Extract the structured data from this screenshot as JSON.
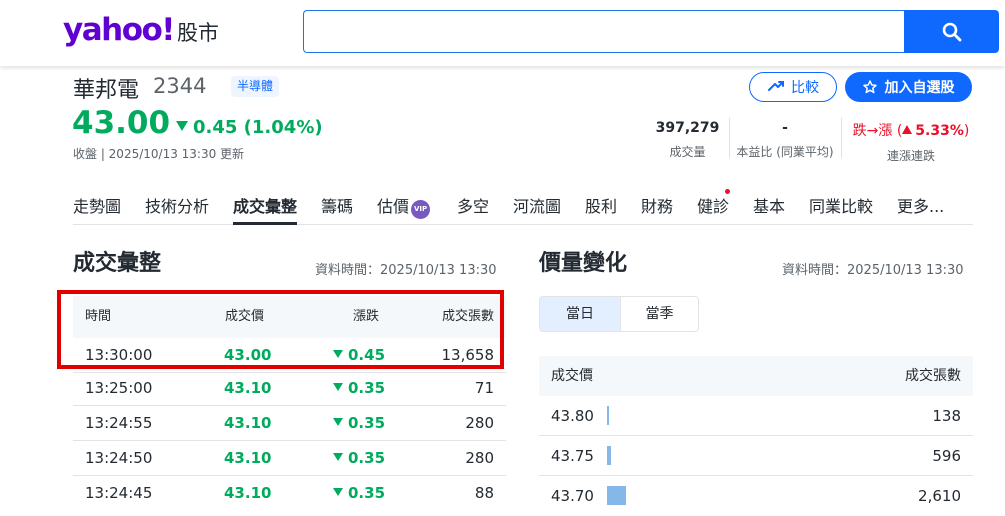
{
  "header": {
    "logo_word": "yahoo!",
    "logo_sub": "股市",
    "search_value": "",
    "search_placeholder": ""
  },
  "stock": {
    "name": "華邦電",
    "code": "2344",
    "sector": "半導體",
    "price": "43.00",
    "change": "0.45 (1.04%)",
    "close_time": "收盤 | 2025/10/13 13:30 更新",
    "compare_label": "比較",
    "watch_label": "加入自選股"
  },
  "stats": [
    {
      "value": "397,279",
      "label": "成交量"
    },
    {
      "value": "-",
      "label": "本益比 (同業平均)"
    },
    {
      "value_prefix": "跌→漲 (",
      "value_pct": "5.33%",
      "value_suffix": ")",
      "label": "連漲連跌"
    }
  ],
  "tabs": [
    "走勢圖",
    "技術分析",
    "成交彙整",
    "籌碼",
    "估價",
    "多空",
    "河流圖",
    "股利",
    "財務",
    "健診",
    "基本",
    "同業比較",
    "更多..."
  ],
  "tabs_vip_badge": "VIP",
  "left": {
    "title": "成交彙整",
    "time": "資料時間：2025/10/13 13:30",
    "headers": [
      "時間",
      "成交價",
      "漲跌",
      "成交張數"
    ],
    "rows": [
      [
        "13:30:00",
        "43.00",
        "0.45",
        "13,658"
      ],
      [
        "13:25:00",
        "43.10",
        "0.35",
        "71"
      ],
      [
        "13:24:55",
        "43.10",
        "0.35",
        "280"
      ],
      [
        "13:24:50",
        "43.10",
        "0.35",
        "280"
      ],
      [
        "13:24:45",
        "43.10",
        "0.35",
        "88"
      ]
    ]
  },
  "right": {
    "title": "價量變化",
    "time": "資料時間：2025/10/13 13:30",
    "segments": [
      "當日",
      "當季"
    ],
    "headers": [
      "成交價",
      "成交張數"
    ],
    "rows": [
      [
        "43.80",
        "138"
      ],
      [
        "43.75",
        "596"
      ],
      [
        "43.70",
        "2,610"
      ]
    ]
  },
  "colors": {
    "down": "#00ab5e",
    "up": "#eb0f29",
    "accent": "#0f69ff",
    "brand": "#6001d2"
  }
}
